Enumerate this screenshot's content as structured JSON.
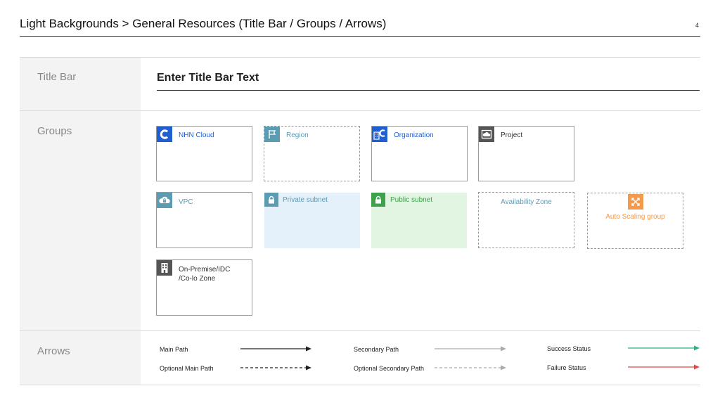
{
  "header": {
    "title": "Light Backgrounds > General Resources (Title Bar / Groups / Arrows)",
    "page_number": "4"
  },
  "sections": {
    "title_bar": "Title Bar",
    "groups": "Groups",
    "arrows": "Arrows"
  },
  "title_bar": {
    "text": "Enter Title Bar Text"
  },
  "groups": {
    "nhn_cloud": "NHN Cloud",
    "region": "Region",
    "organization": "Organization",
    "project": "Project",
    "vpc": "VPC",
    "private_subnet": "Private subnet",
    "public_subnet": "Public subnet",
    "availability_zone": "Availability Zone",
    "auto_scaling_group": "Auto Scaling group",
    "on_premise_line1": "On-Premise/IDC",
    "on_premise_line2": "/Co-lo Zone"
  },
  "arrows": {
    "main_path": "Main Path",
    "optional_main_path": "Optional Main Path",
    "secondary_path": "Secondary Path",
    "optional_secondary_path": "Optional Secondary Path",
    "success_status": "Success Status",
    "failure_status": "Failure Status"
  },
  "colors": {
    "nhn_blue": "#1f5fd1",
    "region_teal": "#5b9cb3",
    "project_gray": "#555555",
    "private_fill": "#e5f1fa",
    "public_fill": "#e2f5e3",
    "public_green": "#3ea14b",
    "asg_orange": "#f29a4e",
    "success_green": "#23b586",
    "failure_red": "#e64646"
  }
}
